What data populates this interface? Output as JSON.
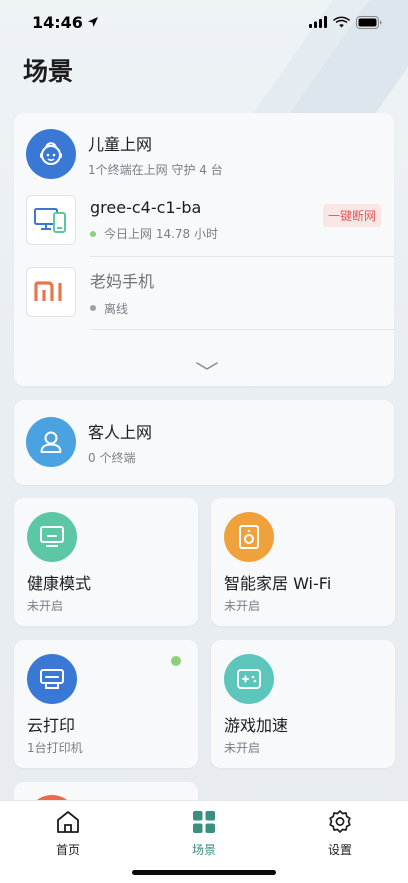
{
  "status_bar": {
    "time": "14:46"
  },
  "page": {
    "title": "场景"
  },
  "kids": {
    "title": "儿童上网",
    "subtitle": "1个终端在上网  守护 4 台",
    "devices": [
      {
        "name": "gree-c4-c1-ba",
        "status": "今日上网 14.78 小时",
        "online": true,
        "action": "一键断网"
      },
      {
        "name": "老妈手机",
        "status": "离线",
        "online": false,
        "brand_label": "mi"
      }
    ]
  },
  "guest": {
    "title": "客人上网",
    "subtitle": "0 个终端"
  },
  "tiles": [
    {
      "title": "健康模式",
      "subtitle": "未开启",
      "icon": "monitor-icon",
      "color": "#5cc7a4"
    },
    {
      "title": "智能家居 Wi-Fi",
      "subtitle": "未开启",
      "icon": "speaker-icon",
      "color": "#efa23c"
    },
    {
      "title": "云打印",
      "subtitle": "1台打印机",
      "icon": "printer-icon",
      "color": "#3a78d6"
    },
    {
      "title": "游戏加速",
      "subtitle": "未开启",
      "icon": "gamepad-icon",
      "color": "#5cc6bd"
    }
  ],
  "tabs": [
    {
      "label": "首页",
      "icon": "home-icon",
      "active": false
    },
    {
      "label": "场景",
      "icon": "grid-icon",
      "active": true
    },
    {
      "label": "设置",
      "icon": "gear-icon",
      "active": false
    }
  ],
  "colors": {
    "accent": "#3a8f7e",
    "kids_avatar": "#3a78d6",
    "guest_avatar": "#4aa2e0",
    "danger": "#e05c5c",
    "online": "#8bd07b"
  }
}
